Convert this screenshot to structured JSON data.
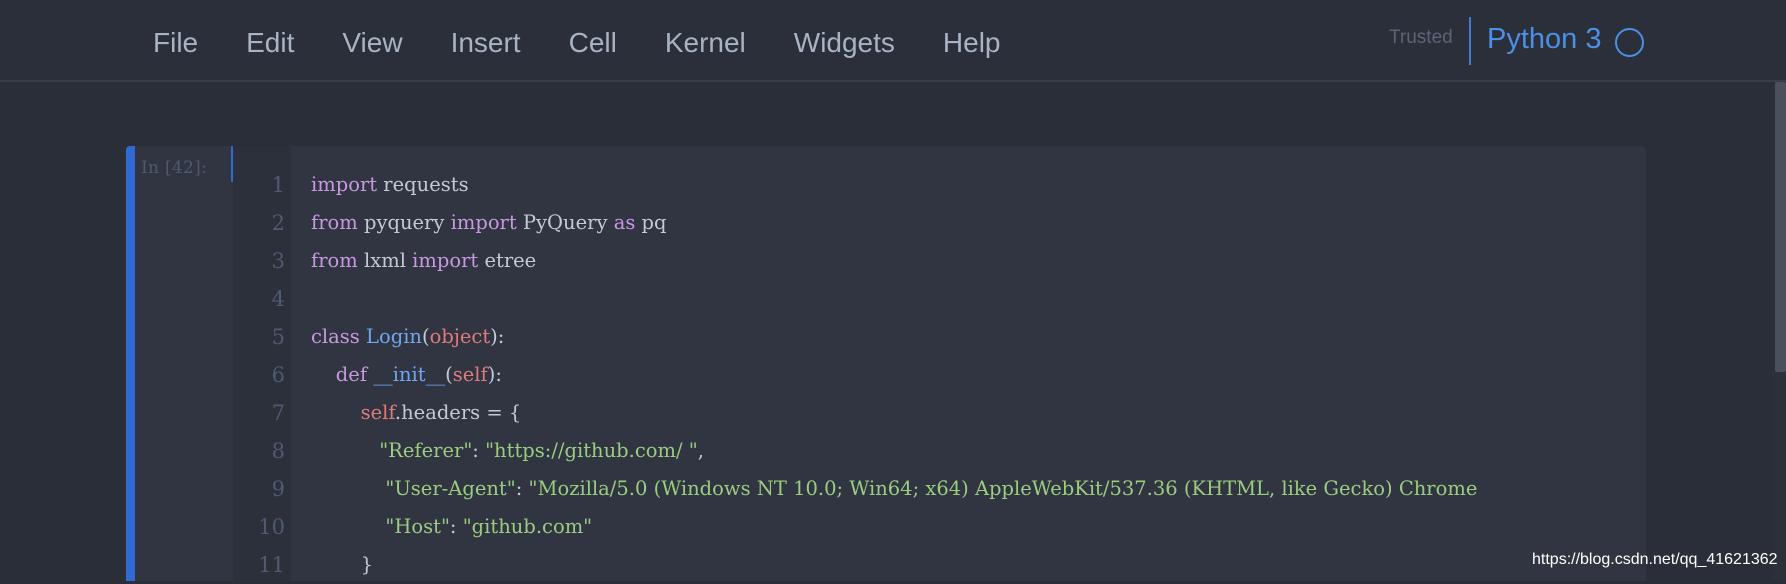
{
  "menubar": {
    "items": [
      "File",
      "Edit",
      "View",
      "Insert",
      "Cell",
      "Kernel",
      "Widgets",
      "Help"
    ],
    "trusted_label": "Trusted",
    "kernel_name": "Python 3"
  },
  "cell": {
    "prompt": "In [42]:",
    "line_numbers": [
      "1",
      "2",
      "3",
      "4",
      "5",
      "6",
      "7",
      "8",
      "9",
      "10",
      "11"
    ],
    "lines": [
      [
        [
          "kw",
          "import"
        ],
        [
          "plain",
          " requests"
        ]
      ],
      [
        [
          "kw",
          "from"
        ],
        [
          "plain",
          " pyquery "
        ],
        [
          "kw",
          "import"
        ],
        [
          "plain",
          " PyQuery "
        ],
        [
          "kw",
          "as"
        ],
        [
          "plain",
          " pq"
        ]
      ],
      [
        [
          "kw",
          "from"
        ],
        [
          "plain",
          " lxml "
        ],
        [
          "kw",
          "import"
        ],
        [
          "plain",
          " etree"
        ]
      ],
      [
        [
          "plain",
          ""
        ]
      ],
      [
        [
          "kw",
          "class"
        ],
        [
          "plain",
          " "
        ],
        [
          "cls",
          "Login"
        ],
        [
          "plain",
          "("
        ],
        [
          "bi",
          "object"
        ],
        [
          "plain",
          "):"
        ]
      ],
      [
        [
          "plain",
          "    "
        ],
        [
          "kw",
          "def"
        ],
        [
          "plain",
          " "
        ],
        [
          "cls",
          "__init__"
        ],
        [
          "plain",
          "("
        ],
        [
          "bi",
          "self"
        ],
        [
          "plain",
          "):"
        ]
      ],
      [
        [
          "plain",
          "        "
        ],
        [
          "bi",
          "self"
        ],
        [
          "plain",
          ".headers = {"
        ]
      ],
      [
        [
          "plain",
          "           "
        ],
        [
          "str",
          "\"Referer\""
        ],
        [
          "plain",
          ": "
        ],
        [
          "str",
          "\"https://github.com/ \""
        ],
        [
          "plain",
          ","
        ]
      ],
      [
        [
          "plain",
          "            "
        ],
        [
          "str",
          "\"User-Agent\""
        ],
        [
          "plain",
          ": "
        ],
        [
          "str",
          "\"Mozilla/5.0 (Windows NT 10.0; Win64; x64) AppleWebKit/537.36 (KHTML, like Gecko) Chrome"
        ]
      ],
      [
        [
          "plain",
          "            "
        ],
        [
          "str",
          "\"Host\""
        ],
        [
          "plain",
          ": "
        ],
        [
          "str",
          "\"github.com\""
        ]
      ],
      [
        [
          "plain",
          "        }"
        ]
      ]
    ]
  },
  "watermark": "https://blog.csdn.net/qq_41621362",
  "colors": {
    "accent": "#2f6bd2",
    "kernel": "#4c8fe6",
    "keyword": "#c899e0",
    "string": "#9bcd80",
    "builtin": "#e07b7b",
    "class": "#70a7f0"
  }
}
